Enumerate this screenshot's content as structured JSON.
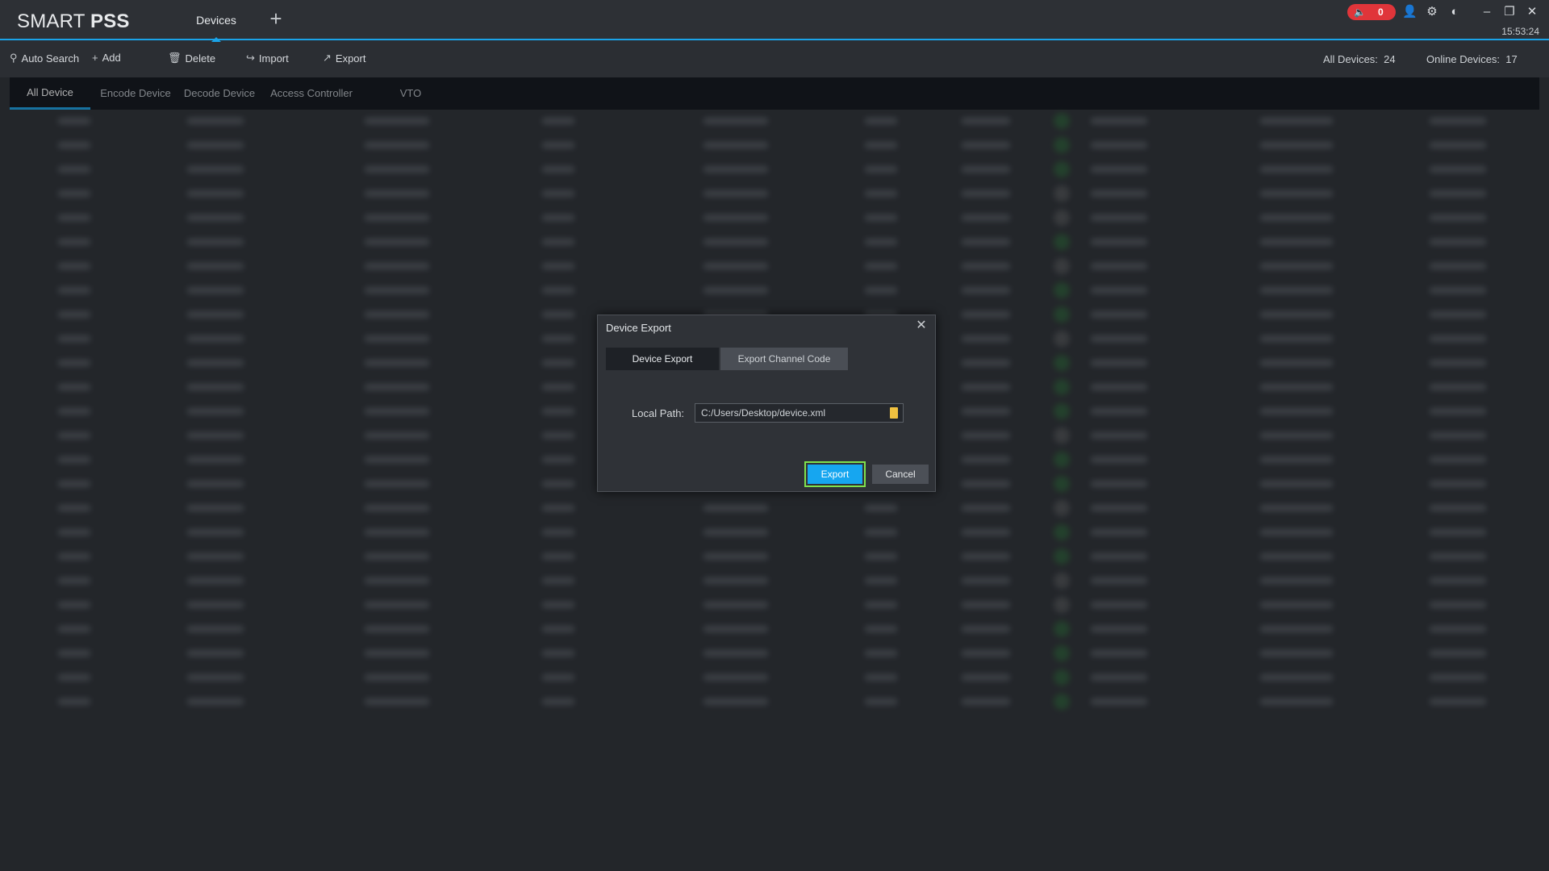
{
  "app": {
    "logo_regular": "SMART ",
    "logo_bold": "PSS",
    "tab_devices": "Devices",
    "add_tab": "+",
    "alarm_count": "0",
    "clock": "15:53:24"
  },
  "toolbar": {
    "auto_search": "Auto Search",
    "add": "Add",
    "delete": "Delete",
    "import": "Import",
    "export": "Export",
    "all_devices_label": "All Devices:",
    "all_devices_value": "24",
    "online_devices_label": "Online Devices:",
    "online_devices_value": "17"
  },
  "subtabs": [
    "All Device",
    "Encode Device",
    "Decode Device",
    "Access Controller",
    "VTO"
  ],
  "dialog": {
    "title": "Device Export",
    "tab_device_export": "Device Export",
    "tab_channel_code": "Export Channel Code",
    "local_path_label": "Local Path:",
    "local_path_value": "C:/Users/Desktop/device.xml",
    "export_button": "Export",
    "cancel_button": "Cancel"
  },
  "colors": {
    "accent": "#1aa3e8",
    "export_button": "#16a6f0",
    "focus_ring": "#7fe24d",
    "alarm": "#e0353a",
    "online": "#2e8b3c"
  }
}
